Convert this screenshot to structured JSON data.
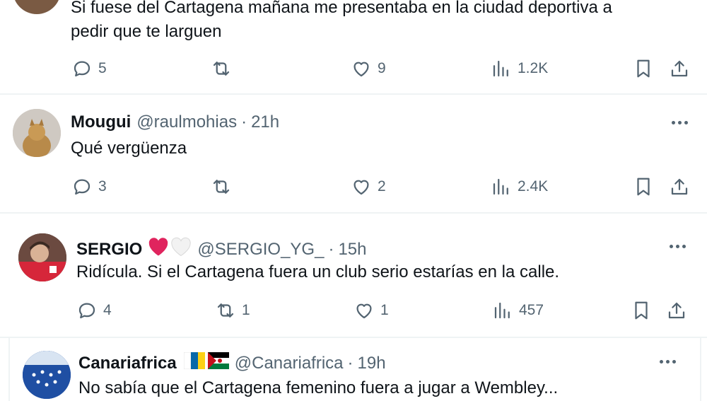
{
  "tweets": [
    {
      "text_lines": [
        "Si fuese del Cartagena mañana me presentaba en la ciudad deportiva a",
        "pedir que te larguen"
      ],
      "replies": "5",
      "retweets": "",
      "likes": "9",
      "views": "1.2K"
    },
    {
      "name": "Mougui",
      "handle": "@raulmohias",
      "dot": "·",
      "time": "21h",
      "text": "Qué vergüenza",
      "replies": "3",
      "retweets": "",
      "likes": "2",
      "views": "2.4K"
    },
    {
      "name": "SERGIO",
      "handle": "@SERGIO_YG_",
      "dot": "·",
      "time": "15h",
      "name_emojis": [
        "red-heart",
        "white-heart"
      ],
      "text": "Ridícula. Si el Cartagena fuera un club serio estarías en la calle.",
      "replies": "4",
      "retweets": "1",
      "likes": "1",
      "views": "457"
    },
    {
      "name": "Canariafrica",
      "handle": "@Canariafrica",
      "dot": "·",
      "time": "19h",
      "name_emojis": [
        "canary-islands-flag",
        "western-sahara-flag"
      ],
      "text": "No sabía que el Cartagena femenino fuera a jugar a Wembley..."
    }
  ],
  "colors": {
    "text": "#0f1419",
    "secondary": "#536471",
    "separator": "#eff3f4",
    "heart_red": "#e0245e"
  }
}
